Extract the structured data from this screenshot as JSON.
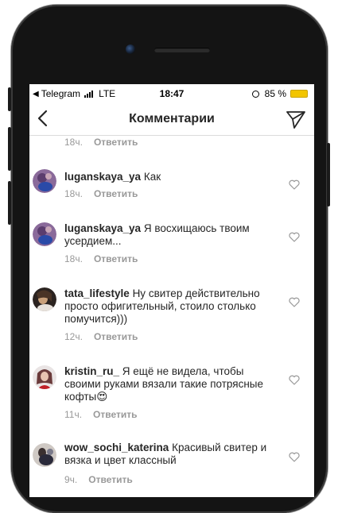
{
  "status_bar": {
    "carrier": "Telegram",
    "network": "LTE",
    "time": "18:47",
    "battery": "85 %"
  },
  "nav": {
    "title": "Комментарии"
  },
  "reply_label": "Ответить",
  "top_fragment": {
    "time": "18ч."
  },
  "comments": [
    {
      "username": "luganskaya_ya",
      "text": "Как",
      "time": "18ч."
    },
    {
      "username": "luganskaya_ya",
      "text": "Я восхищаюсь твоим усердием...",
      "time": "18ч."
    },
    {
      "username": "tata_lifestyle",
      "text": "Ну свитер действительно просто офигительный, стоило столько помучится)))",
      "time": "12ч."
    },
    {
      "username": "kristin_ru_",
      "text": "Я ещё не видела, чтобы своими руками вязали такие потрясные кофты😍",
      "time": "11ч."
    },
    {
      "username": "wow_sochi_katerina",
      "text": "Красивый свитер и вязка и цвет классный",
      "time": "9ч."
    }
  ]
}
